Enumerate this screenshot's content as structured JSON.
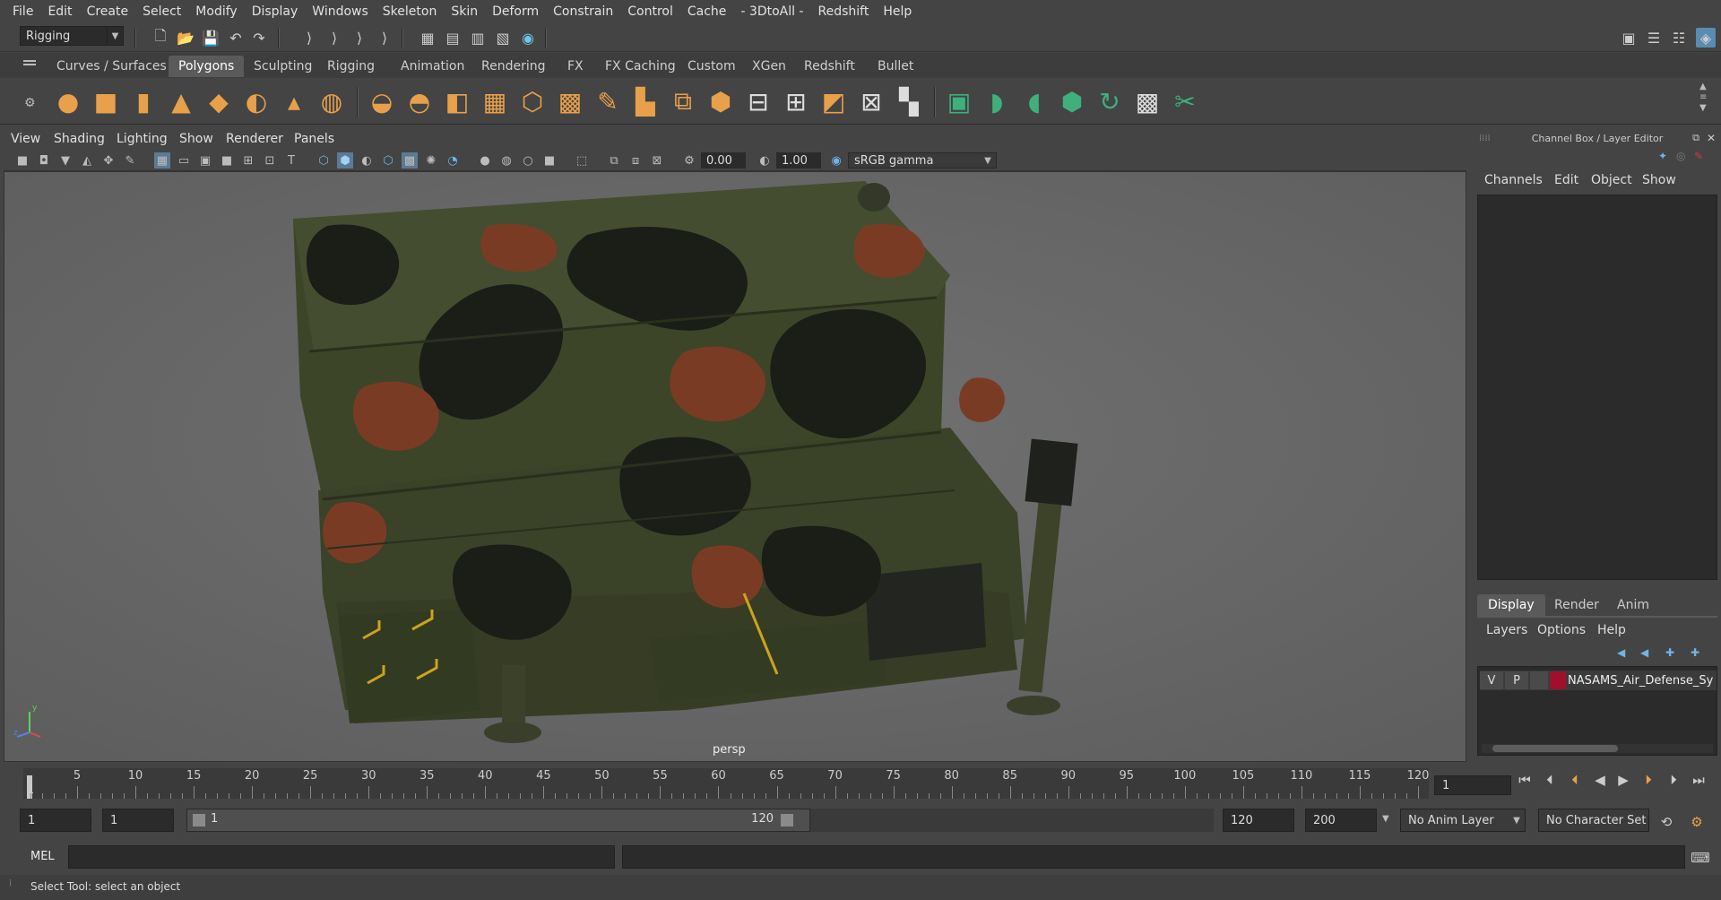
{
  "menubar": {
    "items": [
      "File",
      "Edit",
      "Create",
      "Select",
      "Modify",
      "Display",
      "Windows",
      "Skeleton",
      "Skin",
      "Deform",
      "Constrain",
      "Control",
      "Cache",
      "- 3DtoAll -",
      "Redshift",
      "Help"
    ]
  },
  "status_line": {
    "mode_menu": "Rigging"
  },
  "shelf": {
    "tabs": [
      "Curves / Surfaces",
      "Polygons",
      "Sculpting",
      "Rigging",
      "Animation",
      "Rendering",
      "FX",
      "FX Caching",
      "Custom",
      "XGen",
      "Redshift",
      "Bullet"
    ],
    "active_tab": "Polygons"
  },
  "viewport": {
    "menu": [
      "View",
      "Shading",
      "Lighting",
      "Show",
      "Renderer",
      "Panels"
    ],
    "exposure": "0.00",
    "gamma": "1.00",
    "color_space": "sRGB gamma",
    "camera_label": "persp"
  },
  "channel_box": {
    "title": "Channel Box / Layer Editor",
    "menu": [
      "Channels",
      "Edit",
      "Object",
      "Show"
    ]
  },
  "layer_editor": {
    "tabs": [
      "Display",
      "Render",
      "Anim"
    ],
    "active_tab": "Display",
    "menu": [
      "Layers",
      "Options",
      "Help"
    ],
    "layer": {
      "visible": "V",
      "playback": "P",
      "color": "#a0102a",
      "name": "NASAMS_Air_Defense_Sy"
    }
  },
  "time_slider": {
    "ticks": [
      "1",
      "5",
      "10",
      "15",
      "20",
      "25",
      "30",
      "35",
      "40",
      "45",
      "50",
      "55",
      "60",
      "65",
      "70",
      "75",
      "80",
      "85",
      "90",
      "95",
      "100",
      "105",
      "110",
      "115",
      "120"
    ],
    "current_frame": "1"
  },
  "range_slider": {
    "start_time": "1",
    "playback_start": "1",
    "range_start_label": "1",
    "range_end_label": "120",
    "playback_end": "120",
    "end_time": "200",
    "anim_layer": "No Anim Layer",
    "character_set": "No Character Set"
  },
  "command_line": {
    "language": "MEL"
  },
  "help_line": {
    "text": "Select Tool: select an object"
  }
}
